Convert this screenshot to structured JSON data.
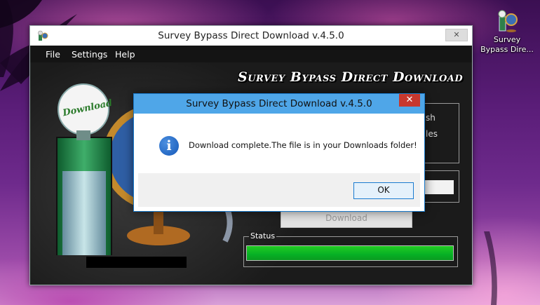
{
  "desktop": {
    "icon_label_line1": "Survey",
    "icon_label_line2": "Bypass Dire..."
  },
  "window": {
    "title": "Survey Bypass Direct Download v.4.5.0",
    "close_glyph": "✕",
    "menu": [
      "File",
      "Settings",
      "Help"
    ],
    "banner": "Survey Bypass Direct Download",
    "download_graphic_label": "Download",
    "panel_partial_text_1": "sh",
    "panel_partial_text_2": "les",
    "download_button": "Download",
    "status_label": "Status",
    "progress_fraction": 1.0
  },
  "dialog": {
    "title": "Survey Bypass Direct Download v.4.5.0",
    "close_glyph": "✕",
    "icon": "info-icon",
    "icon_glyph": "i",
    "message": "Download complete.The file is in your Downloads folder!",
    "ok_label": "OK"
  },
  "colors": {
    "progress_fill": "#06b025",
    "dialog_titlebar": "#4fa6e8",
    "dialog_close": "#c7372d"
  }
}
